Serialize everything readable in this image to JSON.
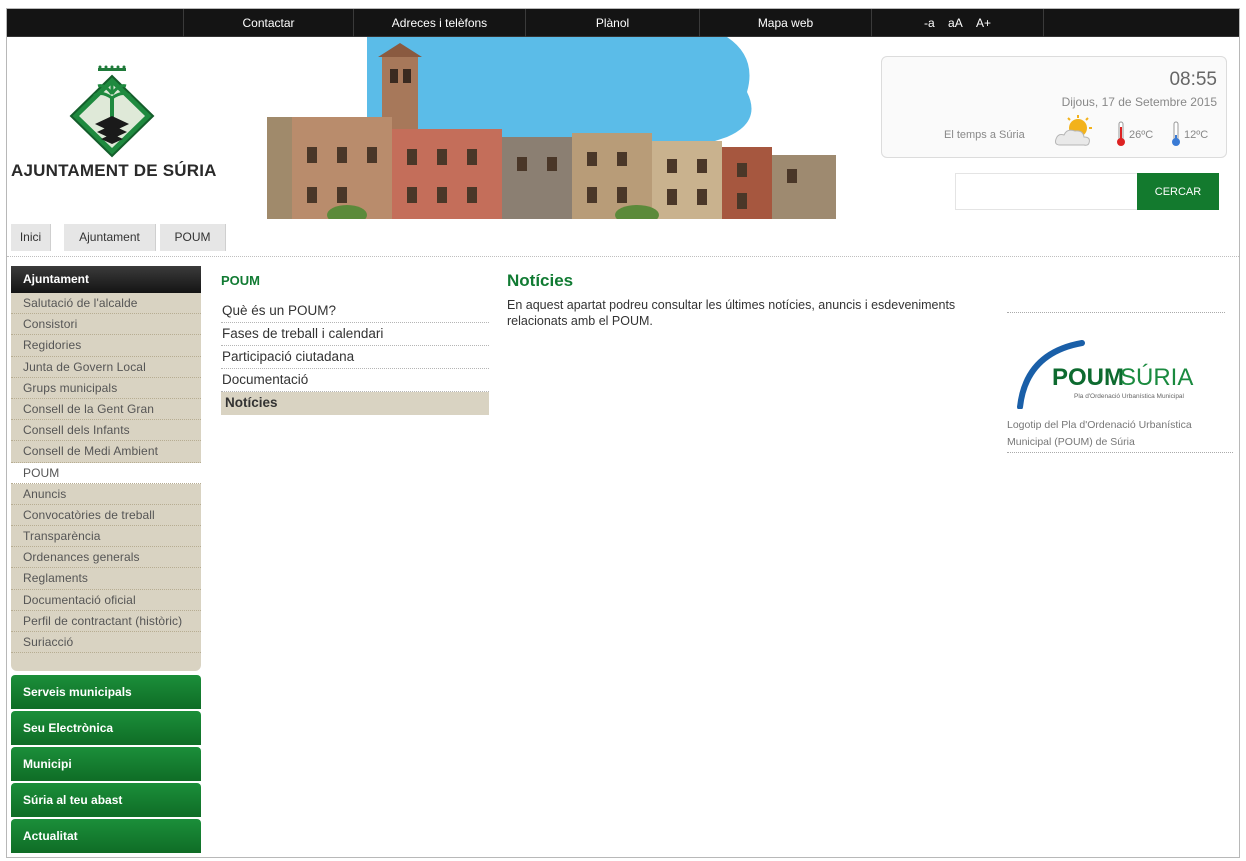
{
  "topnav": {
    "items": [
      "Contactar",
      "Adreces i telèfons",
      "Plànol",
      "Mapa web"
    ],
    "font_sizes": [
      "-a",
      "aA",
      "A+"
    ]
  },
  "header": {
    "site_title": "AJUNTAMENT DE SÚRIA",
    "time": "08:55",
    "date": "Dijous, 17 de Setembre 2015",
    "weather_label": "El temps a Súria",
    "temp_max": "26ºC",
    "temp_min": "12ºC",
    "search_placeholder": "",
    "search_button": "CERCAR"
  },
  "breadcrumb": [
    "Inici",
    "Ajuntament",
    "POUM"
  ],
  "sidebar": {
    "heading": "Ajuntament",
    "items": [
      "Salutació de l'alcalde",
      "Consistori",
      "Regidories",
      "Junta de Govern Local",
      "Grups municipals",
      "Consell de la Gent Gran",
      "Consell dels Infants",
      "Consell de Medi Ambient",
      "POUM",
      "Anuncis",
      "Convocatòries de treball",
      "Transparència",
      "Ordenances generals",
      "Reglaments",
      "Documentació oficial",
      "Perfil de contractant (històric)",
      "Suriacció"
    ],
    "active_index": 8,
    "sections": [
      "Serveis municipals",
      "Seu Electrònica",
      "Municipi",
      "Súria al teu abast",
      "Actualitat"
    ]
  },
  "subnav": {
    "title": "POUM",
    "items": [
      "Què és un POUM?",
      "Fases de treball i calendari",
      "Participació ciutadana",
      "Documentació",
      "Notícies"
    ],
    "active_index": 4
  },
  "content": {
    "title": "Notícies",
    "body": "En aquest apartat podreu consultar les últimes notícies, anuncis i esdeveniments relacionats amb el POUM."
  },
  "aside": {
    "logo_text_bold": "POUM",
    "logo_text_light": "SÚRIA",
    "logo_subtitle": "Pla d'Ordenació Urbanística Municipal",
    "caption": "Logotip del Pla d'Ordenació Urbanística Municipal (POUM) de Súria"
  },
  "colors": {
    "brand_green": "#137a2e",
    "topbar": "#141414",
    "sidebar_bg": "#d9d3c2",
    "sky": "#5bbce8"
  }
}
